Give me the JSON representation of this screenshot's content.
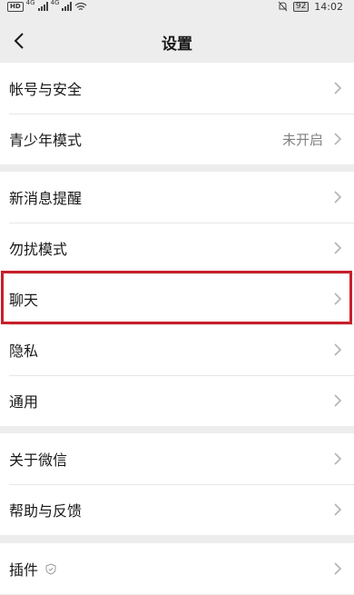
{
  "status": {
    "battery": "92",
    "time": "14:02",
    "net1": "4G",
    "net2": "4G",
    "hd": "HD"
  },
  "nav": {
    "title": "设置"
  },
  "groups": [
    {
      "items": [
        {
          "label": "帐号与安全"
        },
        {
          "label": "青少年模式",
          "value": "未开启"
        }
      ]
    },
    {
      "items": [
        {
          "label": "新消息提醒"
        },
        {
          "label": "勿扰模式"
        },
        {
          "label": "聊天"
        },
        {
          "label": "隐私"
        },
        {
          "label": "通用"
        }
      ]
    },
    {
      "items": [
        {
          "label": "关于微信"
        },
        {
          "label": "帮助与反馈"
        }
      ]
    },
    {
      "items": [
        {
          "label": "插件"
        }
      ]
    }
  ],
  "highlight_color": "#c81f2a"
}
